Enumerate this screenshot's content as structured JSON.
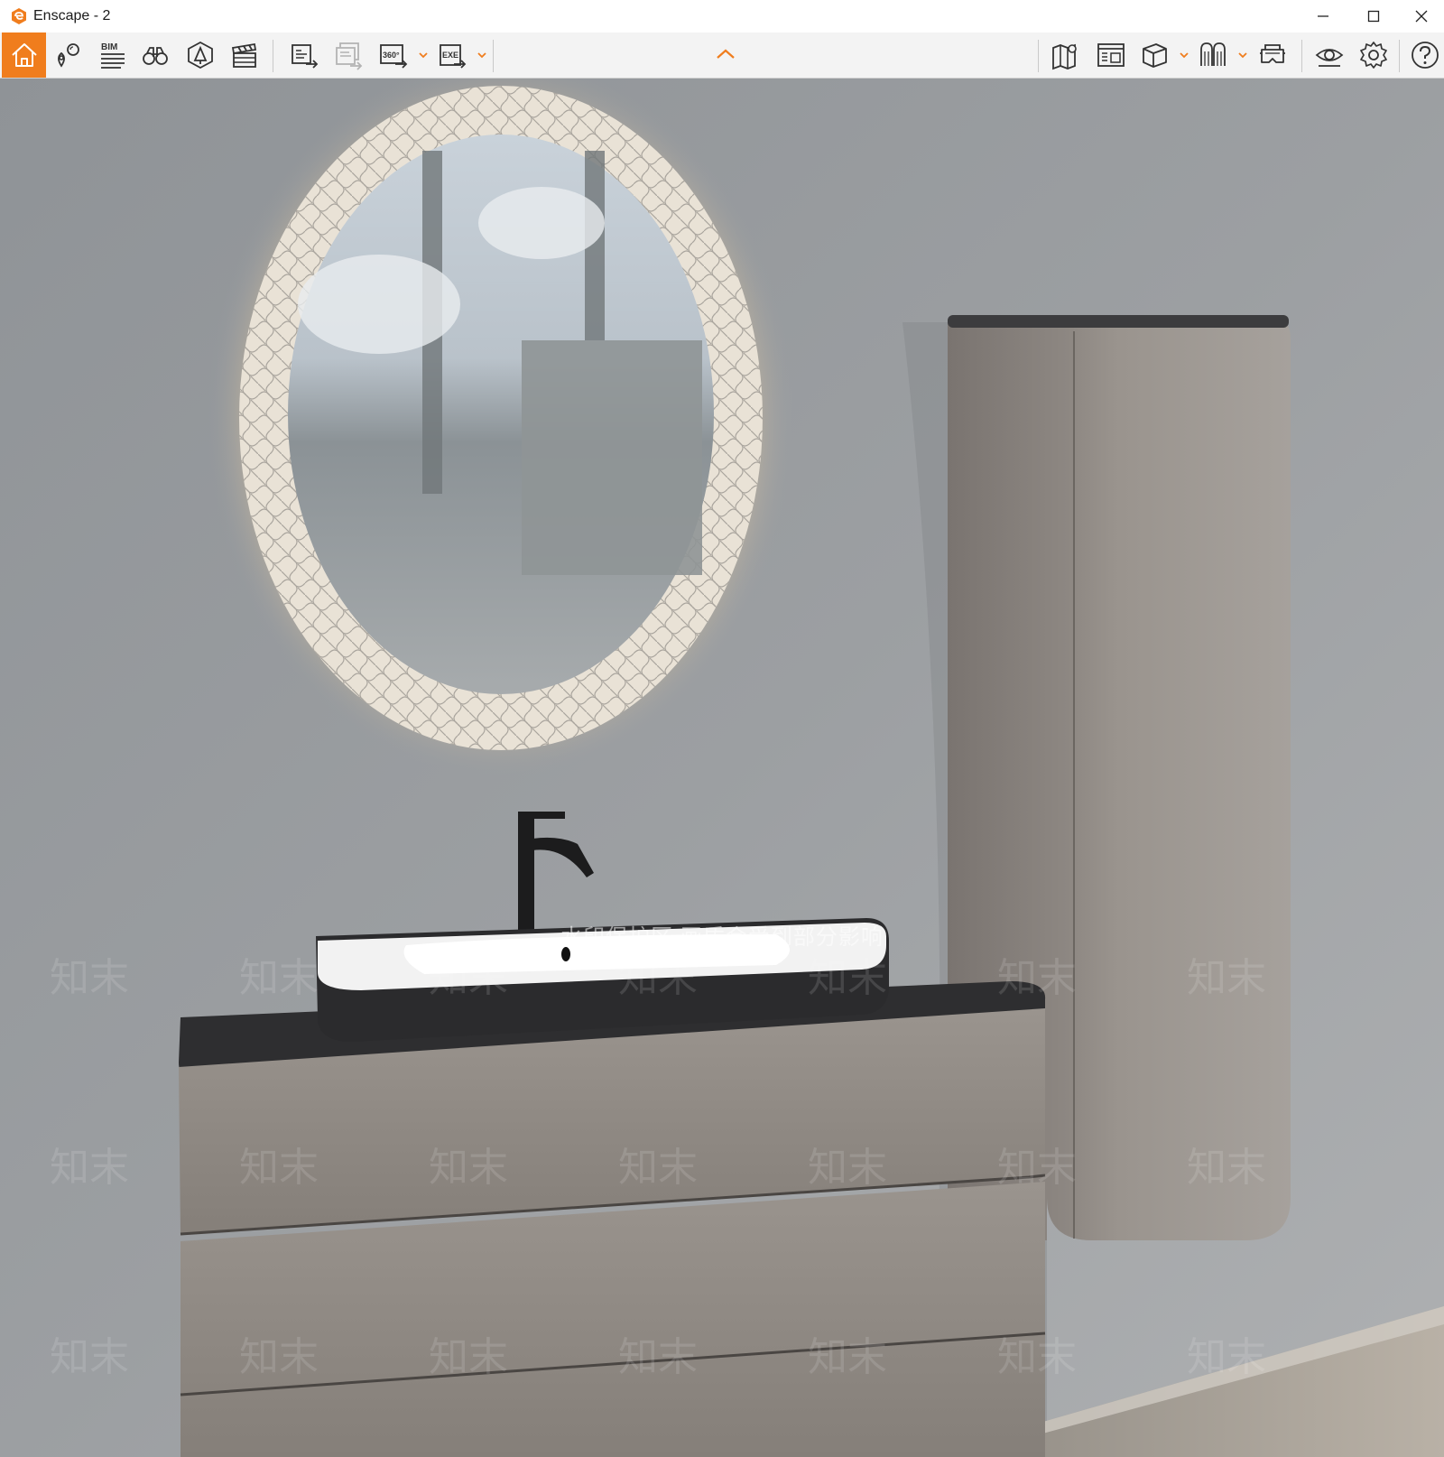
{
  "window": {
    "title": "Enscape - 2",
    "logo_icon": "enscape-logo-icon",
    "controls": [
      "minimize-icon",
      "maximize-icon",
      "close-icon"
    ]
  },
  "toolbar": {
    "accent_color": "#f07d1d",
    "bim_label": "BIM",
    "panorama_label": "360°",
    "exe_label": "EXE",
    "left_tools": [
      "home-icon",
      "views-icon",
      "bim-info-icon",
      "binoculars-icon",
      "asset-library-icon",
      "video-editor-icon",
      "screenshot-export-icon",
      "batch-render-icon",
      "panorama-icon",
      "exe-export-icon"
    ],
    "right_tools": [
      "map-icon",
      "atmosphere-icon",
      "cube-view-icon",
      "material-editor-icon",
      "vr-headset-icon",
      "visual-settings-icon",
      "settings-gear-icon",
      "help-icon"
    ],
    "collapse_icon": "chevron-up-icon"
  },
  "viewport": {
    "watermark_banner": "水印保护区 画质会受到部分影响",
    "watermark_tile": "知末"
  }
}
